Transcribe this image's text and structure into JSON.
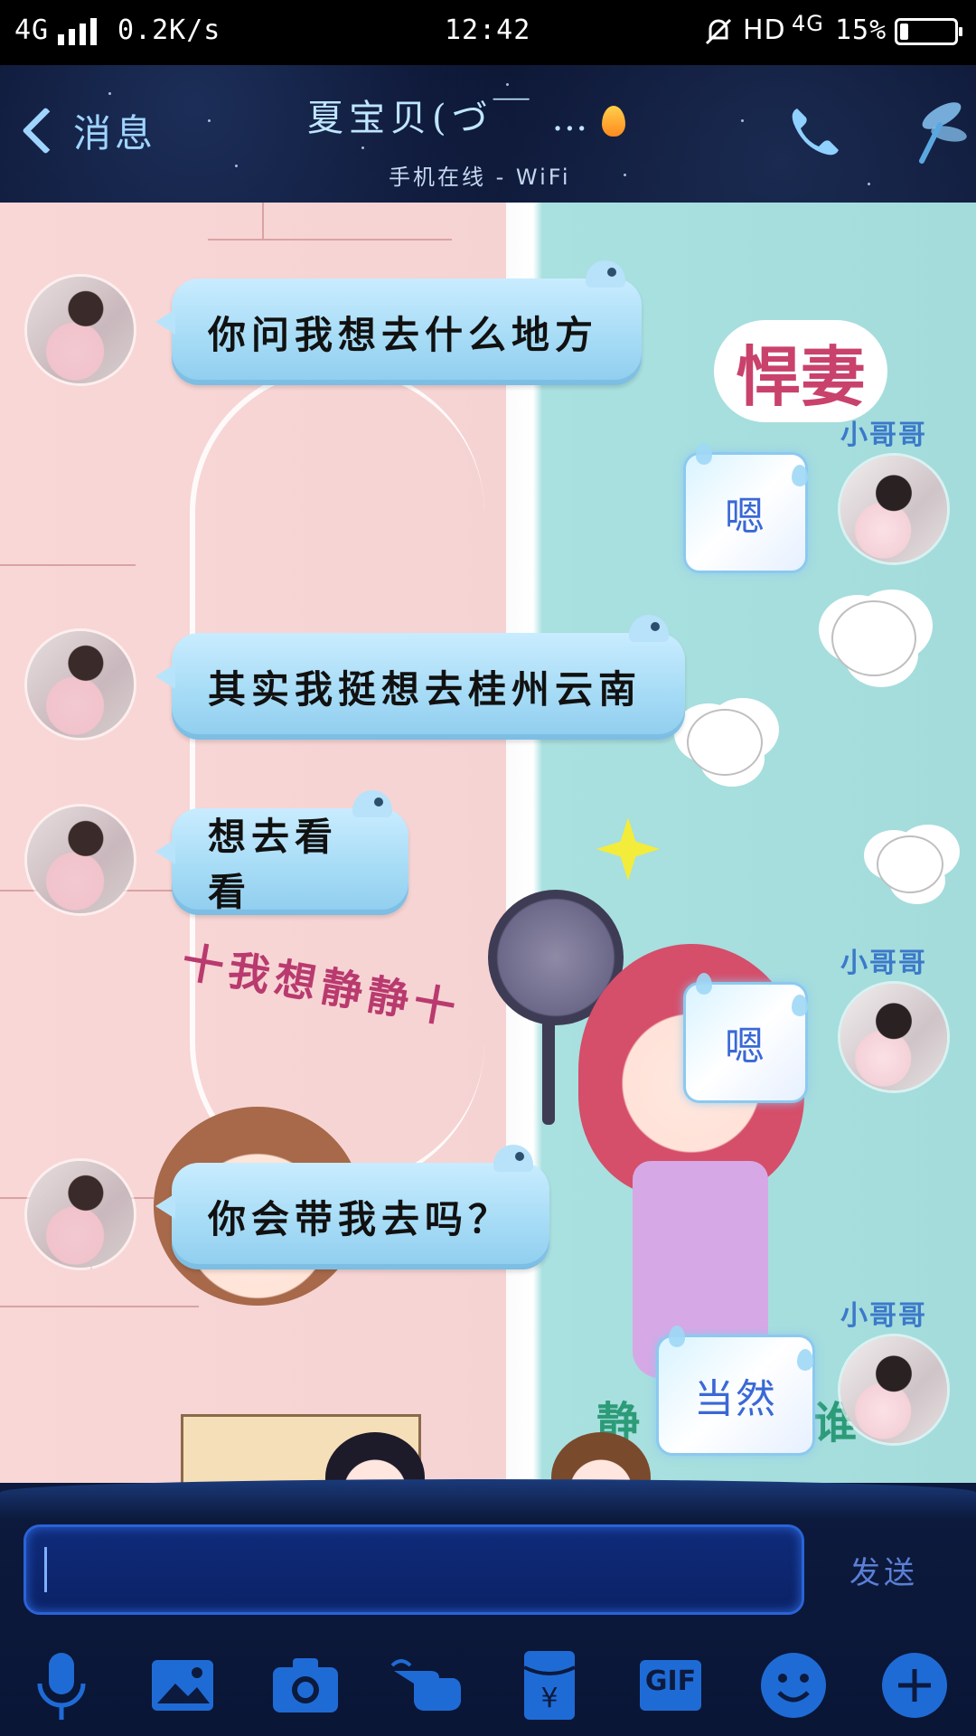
{
  "status_bar": {
    "network": "4G",
    "speed": "0.2K/s",
    "time": "12:42",
    "hd": "HD",
    "network_right": "4G",
    "battery_percent": "15%",
    "battery_level": 0.15
  },
  "header": {
    "back_label": "消息",
    "contact_name": "夏宝贝(づ￣ …",
    "status": "手机在线 - WiFi"
  },
  "background_doodles": {
    "tag_top": "悍妻",
    "caption": "十我想静静十",
    "tag_bottom_partial": "静",
    "tag_bottom_partial2": "谁"
  },
  "messages": [
    {
      "side": "in",
      "text": "你问我想去什么地方"
    },
    {
      "side": "out",
      "text": "嗯",
      "sender_tag": "小哥哥"
    },
    {
      "side": "in",
      "text": "其实我挺想去桂州云南"
    },
    {
      "side": "in",
      "text": "想去看看"
    },
    {
      "side": "out",
      "text": "嗯",
      "sender_tag": "小哥哥"
    },
    {
      "side": "in",
      "text": "你会带我去吗？"
    },
    {
      "side": "out",
      "text": "当然",
      "sender_tag": "小哥哥"
    }
  ],
  "input": {
    "value": "",
    "send_label": "发送"
  },
  "toolbar": {
    "gif_label": "GIF",
    "icons": [
      "microphone-icon",
      "image-icon",
      "camera-icon",
      "poke-icon",
      "red-packet-icon",
      "gif-icon",
      "emoji-icon",
      "plus-icon"
    ]
  },
  "colors": {
    "header_bg": "#0b1330",
    "bubble_in": "#a7dcf6",
    "bubble_out_text": "#3a68d6",
    "input_bg": "#0c1a3d",
    "accent": "#2a63d6"
  }
}
